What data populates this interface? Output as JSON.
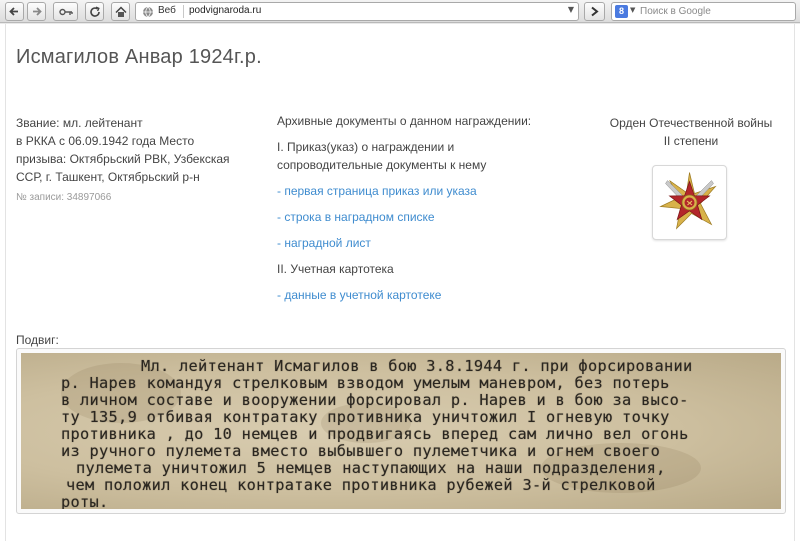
{
  "browser": {
    "address_label": "Веб",
    "url": "podvignaroda.ru",
    "search_placeholder": "Поиск в Google",
    "search_engine_icon": "8"
  },
  "page": {
    "title": "Исмагилов Анвар 1924г.р.",
    "person": {
      "info_lines": [
        "Звание: мл. лейтенант",
        "в РККА с 06.09.1942 года Место",
        "призыва: Октябрьский РВК, Узбекская",
        "ССР, г. Ташкент, Октябрьский р-н"
      ],
      "record": "№ записи: 34897066"
    },
    "archive": {
      "heading": "Архивные документы о данном награждении:",
      "section1_line1": "I. Приказ(указ) о награждении и",
      "section1_line2": "сопроводительные документы к нему",
      "links1": [
        "- первая страница приказ или указа",
        "- строка в наградном списке",
        "- наградной лист"
      ],
      "section2": "II. Учетная картотека",
      "links2": [
        "- данные в учетной картотеке"
      ]
    },
    "award": {
      "line1": "Орден Отечественной войны",
      "line2": "II степени",
      "image_icon": "order-patriotic-war-medal-icon",
      "colors": {
        "star_red": "#b3262b",
        "rays_gold": "#d8b24a"
      }
    },
    "feat": {
      "label": "Подвиг:",
      "lines": [
        "Мл. лейтенант Исмагилов в бою 3.8.1944 г. при форсировании",
        "р. Нарев командуя стрелковым взводом умелым маневром, без потерь",
        "в личном составе и вооружении форсировал р. Нарев и в бою за высо-",
        "ту 135,9 отбивая контратаку противника уничтожил I огневую точку",
        "противника , до 10 немцев и продвигаясь вперед сам лично вел огонь",
        "из ручного пулемета вместо выбывшего пулеметчика и огнем своего",
        "пулемета уничтожил 5 немцев наступающих на наши подразделения,",
        "чем положил конец контратаке противника рубежей 3-й стрелковой",
        "роты."
      ]
    }
  },
  "colors": {
    "link": "#3f8ccf",
    "text": "#444444",
    "title": "#555555"
  }
}
